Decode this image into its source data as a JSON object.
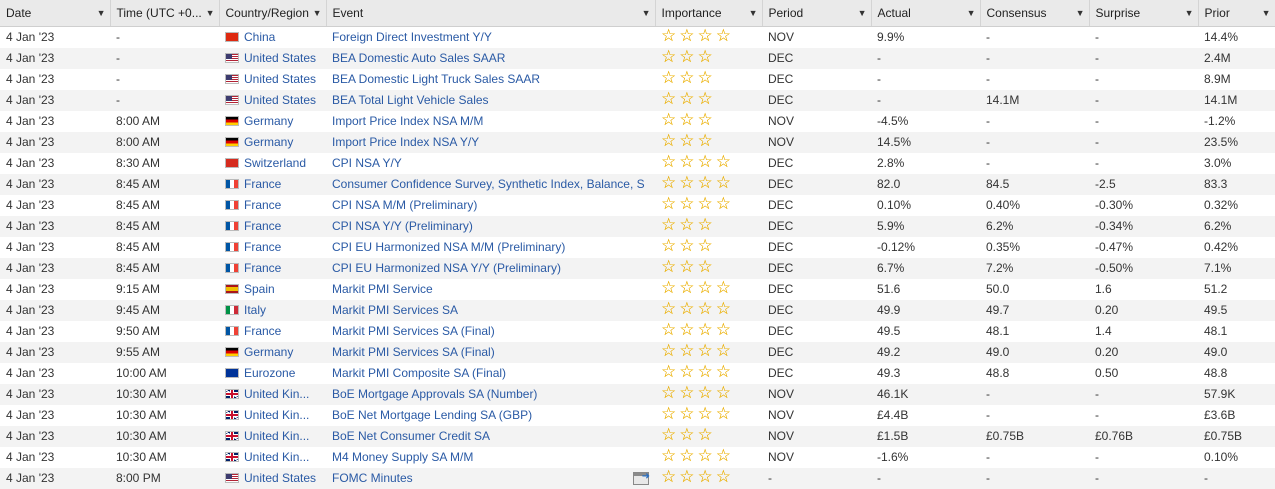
{
  "columns": [
    {
      "label": "Date"
    },
    {
      "label": "Time (UTC +0..."
    },
    {
      "label": "Country/Region"
    },
    {
      "label": "Event"
    },
    {
      "label": "Importance"
    },
    {
      "label": "Period"
    },
    {
      "label": "Actual"
    },
    {
      "label": "Consensus"
    },
    {
      "label": "Surprise"
    },
    {
      "label": "Prior"
    }
  ],
  "rows": [
    {
      "date": "4 Jan '23",
      "time": "-",
      "flag": "cn",
      "country": "China",
      "event": "Foreign Direct Investment Y/Y",
      "stars": 4,
      "period": "NOV",
      "actual": "9.9%",
      "consensus": "-",
      "surprise": "-",
      "prior": "14.4%"
    },
    {
      "date": "4 Jan '23",
      "time": "-",
      "flag": "us",
      "country": "United States",
      "event": "BEA Domestic Auto Sales SAAR",
      "stars": 3,
      "period": "DEC",
      "actual": "-",
      "consensus": "-",
      "surprise": "-",
      "prior": "2.4M"
    },
    {
      "date": "4 Jan '23",
      "time": "-",
      "flag": "us",
      "country": "United States",
      "event": "BEA Domestic Light Truck Sales SAAR",
      "stars": 3,
      "period": "DEC",
      "actual": "-",
      "consensus": "-",
      "surprise": "-",
      "prior": "8.9M"
    },
    {
      "date": "4 Jan '23",
      "time": "-",
      "flag": "us",
      "country": "United States",
      "event": "BEA Total Light Vehicle Sales",
      "stars": 3,
      "period": "DEC",
      "actual": "-",
      "consensus": "14.1M",
      "surprise": "-",
      "prior": "14.1M"
    },
    {
      "date": "4 Jan '23",
      "time": "8:00 AM",
      "flag": "de",
      "country": "Germany",
      "event": "Import Price Index NSA M/M",
      "stars": 3,
      "period": "NOV",
      "actual": "-4.5%",
      "consensus": "-",
      "surprise": "-",
      "prior": "-1.2%"
    },
    {
      "date": "4 Jan '23",
      "time": "8:00 AM",
      "flag": "de",
      "country": "Germany",
      "event": "Import Price Index NSA Y/Y",
      "stars": 3,
      "period": "NOV",
      "actual": "14.5%",
      "consensus": "-",
      "surprise": "-",
      "prior": "23.5%"
    },
    {
      "date": "4 Jan '23",
      "time": "8:30 AM",
      "flag": "ch",
      "country": "Switzerland",
      "event": "CPI NSA Y/Y",
      "stars": 4,
      "period": "DEC",
      "actual": "2.8%",
      "consensus": "-",
      "surprise": "-",
      "prior": "3.0%"
    },
    {
      "date": "4 Jan '23",
      "time": "8:45 AM",
      "flag": "fr",
      "country": "France",
      "event": "Consumer Confidence Survey, Synthetic Index, Balance, S",
      "stars": 4,
      "period": "DEC",
      "actual": "82.0",
      "consensus": "84.5",
      "surprise": "-2.5",
      "prior": "83.3"
    },
    {
      "date": "4 Jan '23",
      "time": "8:45 AM",
      "flag": "fr",
      "country": "France",
      "event": "CPI NSA M/M (Preliminary)",
      "stars": 4,
      "period": "DEC",
      "actual": "0.10%",
      "consensus": "0.40%",
      "surprise": "-0.30%",
      "prior": "0.32%"
    },
    {
      "date": "4 Jan '23",
      "time": "8:45 AM",
      "flag": "fr",
      "country": "France",
      "event": "CPI NSA Y/Y (Preliminary)",
      "stars": 3,
      "period": "DEC",
      "actual": "5.9%",
      "consensus": "6.2%",
      "surprise": "-0.34%",
      "prior": "6.2%"
    },
    {
      "date": "4 Jan '23",
      "time": "8:45 AM",
      "flag": "fr",
      "country": "France",
      "event": "CPI EU Harmonized NSA M/M (Preliminary)",
      "stars": 3,
      "period": "DEC",
      "actual": "-0.12%",
      "consensus": "0.35%",
      "surprise": "-0.47%",
      "prior": "0.42%"
    },
    {
      "date": "4 Jan '23",
      "time": "8:45 AM",
      "flag": "fr",
      "country": "France",
      "event": "CPI EU Harmonized NSA Y/Y (Preliminary)",
      "stars": 3,
      "period": "DEC",
      "actual": "6.7%",
      "consensus": "7.2%",
      "surprise": "-0.50%",
      "prior": "7.1%"
    },
    {
      "date": "4 Jan '23",
      "time": "9:15 AM",
      "flag": "es",
      "country": "Spain",
      "event": "Markit PMI Service",
      "stars": 4,
      "period": "DEC",
      "actual": "51.6",
      "consensus": "50.0",
      "surprise": "1.6",
      "prior": "51.2"
    },
    {
      "date": "4 Jan '23",
      "time": "9:45 AM",
      "flag": "it",
      "country": "Italy",
      "event": "Markit PMI Services SA",
      "stars": 4,
      "period": "DEC",
      "actual": "49.9",
      "consensus": "49.7",
      "surprise": "0.20",
      "prior": "49.5"
    },
    {
      "date": "4 Jan '23",
      "time": "9:50 AM",
      "flag": "fr",
      "country": "France",
      "event": "Markit PMI Services SA (Final)",
      "stars": 4,
      "period": "DEC",
      "actual": "49.5",
      "consensus": "48.1",
      "surprise": "1.4",
      "prior": "48.1"
    },
    {
      "date": "4 Jan '23",
      "time": "9:55 AM",
      "flag": "de",
      "country": "Germany",
      "event": "Markit PMI Services SA (Final)",
      "stars": 4,
      "period": "DEC",
      "actual": "49.2",
      "consensus": "49.0",
      "surprise": "0.20",
      "prior": "49.0"
    },
    {
      "date": "4 Jan '23",
      "time": "10:00 AM",
      "flag": "eu",
      "country": "Eurozone",
      "event": "Markit PMI Composite SA (Final)",
      "stars": 4,
      "period": "DEC",
      "actual": "49.3",
      "consensus": "48.8",
      "surprise": "0.50",
      "prior": "48.8"
    },
    {
      "date": "4 Jan '23",
      "time": "10:30 AM",
      "flag": "gb",
      "country": "United Kin...",
      "event": "BoE Mortgage Approvals SA (Number)",
      "stars": 4,
      "period": "NOV",
      "actual": "46.1K",
      "consensus": "-",
      "surprise": "-",
      "prior": "57.9K"
    },
    {
      "date": "4 Jan '23",
      "time": "10:30 AM",
      "flag": "gb",
      "country": "United Kin...",
      "event": "BoE Net Mortgage Lending SA (GBP)",
      "stars": 4,
      "period": "NOV",
      "actual": "£4.4B",
      "consensus": "-",
      "surprise": "-",
      "prior": "£3.6B"
    },
    {
      "date": "4 Jan '23",
      "time": "10:30 AM",
      "flag": "gb",
      "country": "United Kin...",
      "event": "BoE Net Consumer Credit SA",
      "stars": 3,
      "period": "NOV",
      "actual": "£1.5B",
      "consensus": "£0.75B",
      "surprise": "£0.76B",
      "prior": "£0.75B"
    },
    {
      "date": "4 Jan '23",
      "time": "10:30 AM",
      "flag": "gb",
      "country": "United Kin...",
      "event": "M4 Money Supply SA M/M",
      "stars": 4,
      "period": "NOV",
      "actual": "-1.6%",
      "consensus": "-",
      "surprise": "-",
      "prior": "0.10%"
    },
    {
      "date": "4 Jan '23",
      "time": "8:00 PM",
      "flag": "us",
      "country": "United States",
      "event": "FOMC Minutes",
      "stars": 4,
      "period": "-",
      "actual": "-",
      "consensus": "-",
      "surprise": "-",
      "prior": "-",
      "icon": "calendar-export-icon"
    }
  ]
}
